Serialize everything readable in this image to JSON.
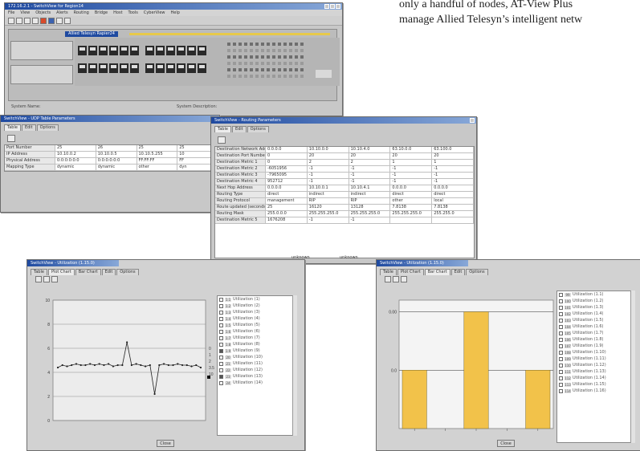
{
  "intro_text": {
    "line1": "only a handful of nodes, AT-View Plus",
    "line2": "manage Allied Telesyn’s intelligent netw"
  },
  "main_window": {
    "title": "172.16.2.1 - SwitchView for Region14",
    "menu": [
      "File",
      "View",
      "Objects",
      "Alerts",
      "Routing",
      "Bridge",
      "Host",
      "Tools",
      "CyberView",
      "Help"
    ],
    "device_label": "Allied Telesyn Rapier24",
    "status_left": "System Name:",
    "status_right": "System Description:"
  },
  "udp_window": {
    "title": "SwitchView - UDP Table Parameters",
    "tabs": [
      "Table",
      "Edit",
      "Options"
    ],
    "rows": [
      {
        "label": "Port Number",
        "cells": [
          "25",
          "26",
          "25",
          "25"
        ]
      },
      {
        "label": "IP Address",
        "cells": [
          "10.10.0.2",
          "10.10.0.5",
          "10.10.5.255",
          "10"
        ]
      },
      {
        "label": "Physical Address",
        "cells": [
          "0:0:0:0:0:0",
          "0:0:0:0:0:0",
          "FF:FF:FF",
          "FF"
        ]
      },
      {
        "label": "Mapping Type",
        "cells": [
          "dynamic",
          "dynamic",
          "other",
          "dyn"
        ]
      }
    ]
  },
  "routing_window": {
    "title": "SwitchView - Routing Parameters",
    "tabs": [
      "Table",
      "Edit",
      "Options"
    ],
    "rows": [
      {
        "label": "Destination Network Addr",
        "cells": [
          "0.0.0.0",
          "10.10.0.0",
          "10.10.4.0",
          "63.10.0.0",
          "63.100.0"
        ]
      },
      {
        "label": "Destination Port Number",
        "cells": [
          "0",
          "20",
          "20",
          "20",
          "20"
        ]
      },
      {
        "label": "Destination Metric 1",
        "cells": [
          "0",
          "2",
          "2",
          "1",
          "1"
        ]
      },
      {
        "label": "Destination Metric 2",
        "cells": [
          "-6051956",
          "-1",
          "-1",
          "-1",
          "-1"
        ]
      },
      {
        "label": "Destination Metric 3",
        "cells": [
          "-7965095",
          "-1",
          "-1",
          "-1",
          "-1"
        ]
      },
      {
        "label": "Destination Metric 4",
        "cells": [
          "952712",
          "-1",
          "-1",
          "-1",
          "-1"
        ]
      },
      {
        "label": "Next Hop Address",
        "cells": [
          "0.0.0.0",
          "10.10.0.1",
          "10.10.4.1",
          "0.0.0.0",
          "0.0.0.0"
        ]
      },
      {
        "label": "Routing Type",
        "cells": [
          "direct",
          "indirect",
          "indirect",
          "direct",
          "direct"
        ]
      },
      {
        "label": "Routing Protocol",
        "cells": [
          "management",
          "RIP",
          "RIP",
          "other",
          "local"
        ]
      },
      {
        "label": "Route updated (seconds)",
        "cells": [
          "25",
          "16120",
          "13128",
          "7.8138",
          "7.8138"
        ]
      },
      {
        "label": "Routing Mask",
        "cells": [
          "255.0.0.0",
          "255.255.255.0",
          "255.255.255.0",
          "255.255.255.0",
          "255.255.0"
        ]
      },
      {
        "label": "Destination Metric 5",
        "cells": [
          "1676208",
          "-1",
          "-1",
          "",
          ""
        ]
      }
    ],
    "partial_labels": [
      "unknown",
      "unknown"
    ]
  },
  "line_window": {
    "title": "SwitchView - Utilization (1.15.0)",
    "tabs": [
      "Table",
      "Plot Chart",
      "Bar Chart",
      "Edit",
      "Options"
    ],
    "yticks": [
      "10",
      "8",
      "6",
      "4",
      "2",
      "0"
    ],
    "legend_side": [
      "0",
      "1",
      "2",
      "3.5",
      "10"
    ],
    "list": [
      {
        "num": "1.1",
        "label": "Utilization (1)",
        "checked": false
      },
      {
        "num": "1.2",
        "label": "Utilization (2)",
        "checked": false
      },
      {
        "num": "1.3",
        "label": "Utilization (3)",
        "checked": false
      },
      {
        "num": "1.4",
        "label": "Utilization (4)",
        "checked": false
      },
      {
        "num": "1.5",
        "label": "Utilization (5)",
        "checked": false
      },
      {
        "num": "1.6",
        "label": "Utilization (6)",
        "checked": false
      },
      {
        "num": "1.7",
        "label": "Utilization (7)",
        "checked": false
      },
      {
        "num": "1.8",
        "label": "Utilization (8)",
        "checked": false
      },
      {
        "num": "1.9",
        "label": "Utilization (9)",
        "checked": true
      },
      {
        "num": "20",
        "label": "Utilization (10)",
        "checked": false
      },
      {
        "num": "21",
        "label": "Utilization (11)",
        "checked": false
      },
      {
        "num": "22",
        "label": "Utilization (12)",
        "checked": false
      },
      {
        "num": "23",
        "label": "Utilization (13)",
        "checked": true
      },
      {
        "num": "24",
        "label": "Utilization (14)",
        "checked": false
      }
    ],
    "close_label": "Close",
    "chart_data": {
      "type": "line",
      "x": [
        1,
        2,
        3,
        4,
        5,
        6,
        7,
        8,
        9,
        10,
        11,
        12,
        13,
        14,
        15,
        16,
        17,
        18,
        19,
        20,
        21,
        22,
        23,
        24,
        25,
        26,
        27,
        28,
        29,
        30,
        31,
        32
      ],
      "series": [
        {
          "values": [
            4.4,
            4.6,
            4.5,
            4.6,
            4.7,
            4.6,
            4.6,
            4.7,
            4.6,
            4.7,
            4.6,
            4.7,
            4.5,
            4.6,
            4.6,
            6.5,
            4.6,
            4.7,
            4.6,
            4.5,
            4.6,
            2.2,
            4.6,
            4.7,
            4.6,
            4.6,
            4.7,
            4.6,
            4.6,
            4.5,
            4.6,
            4.4
          ],
          "color": "#222222"
        }
      ],
      "ylim": [
        0,
        10
      ],
      "grid": true
    }
  },
  "bar_window": {
    "title": "SwitchView - Utilization (1.15.0)",
    "tabs": [
      "Table",
      "Plot Chart",
      "Bar Chart",
      "Edit",
      "Options"
    ],
    "yticks": [
      "0.00",
      "0.0"
    ],
    "list": [
      {
        "num": "99",
        "label": "Utilization (1.1)"
      },
      {
        "num": "100",
        "label": "Utilization (1.2)"
      },
      {
        "num": "101",
        "label": "Utilization (1.3)"
      },
      {
        "num": "102",
        "label": "Utilization (1.4)"
      },
      {
        "num": "103",
        "label": "Utilization (1.5)"
      },
      {
        "num": "104",
        "label": "Utilization (1.6)"
      },
      {
        "num": "105",
        "label": "Utilization (1.7)"
      },
      {
        "num": "106",
        "label": "Utilization (1.8)"
      },
      {
        "num": "107",
        "label": "Utilization (1.9)"
      },
      {
        "num": "108",
        "label": "Utilization (1.10)"
      },
      {
        "num": "109",
        "label": "Utilization (1.11)"
      },
      {
        "num": "110",
        "label": "Utilization (1.12)"
      },
      {
        "num": "111",
        "label": "Utilization (1.13)"
      },
      {
        "num": "112",
        "label": "Utilization (1.14)"
      },
      {
        "num": "113",
        "label": "Utilization (1.15)"
      },
      {
        "num": "114",
        "label": "Utilization (1.16)"
      }
    ],
    "close_label": "Close",
    "chart_data": {
      "type": "bar",
      "categories": [
        "1",
        "2",
        "3",
        "4",
        "5"
      ],
      "values": [
        1,
        0,
        2,
        0,
        1
      ],
      "ylim": [
        0,
        2.2
      ],
      "bar_color": "#f2c24a",
      "grid": true
    }
  }
}
